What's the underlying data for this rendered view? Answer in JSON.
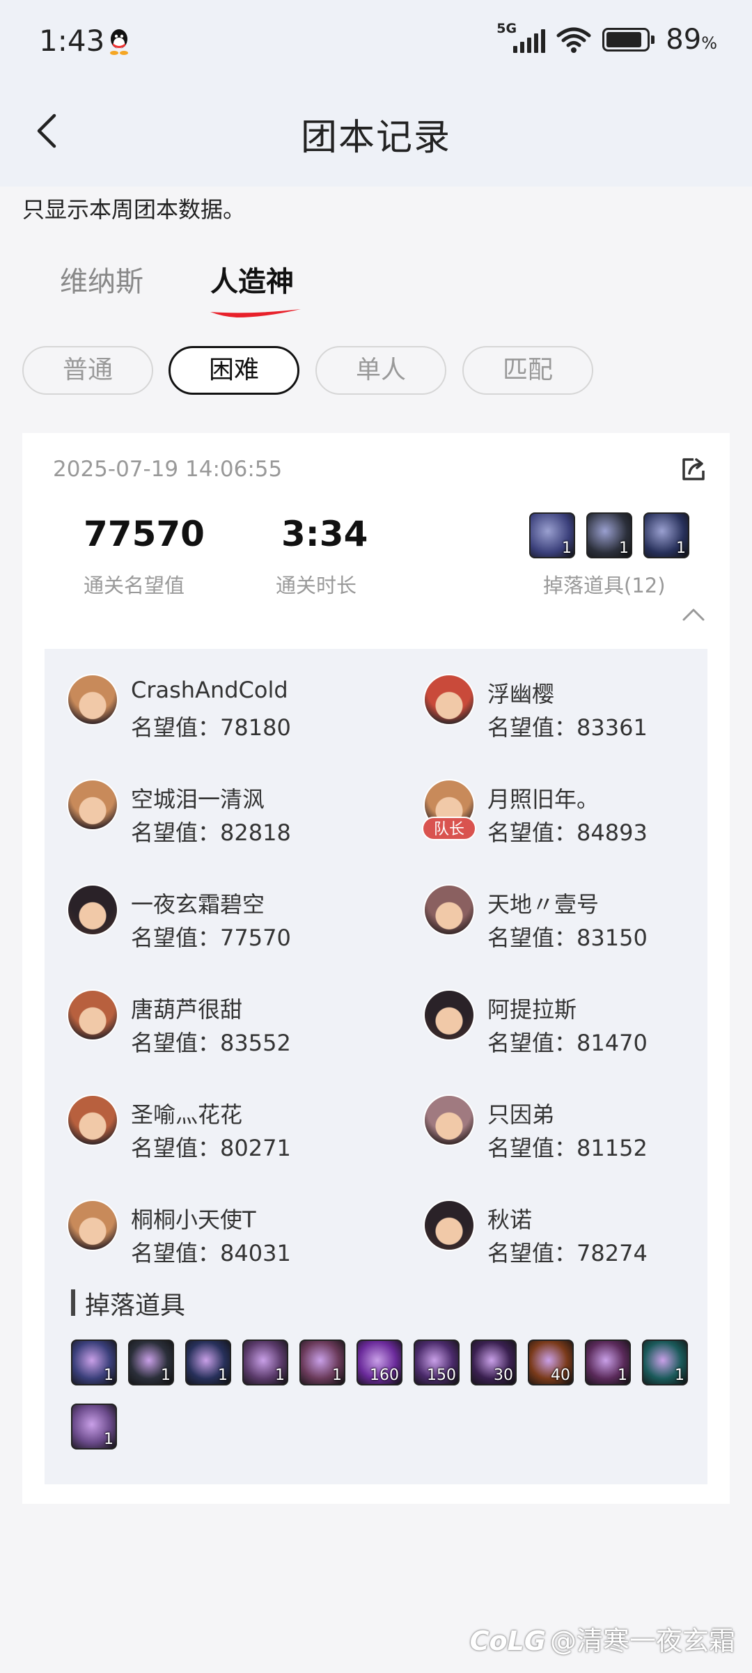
{
  "status_bar": {
    "time": "1:43",
    "network": "5G",
    "battery_percent": "89",
    "battery_unit": "%"
  },
  "header": {
    "title": "团本记录"
  },
  "notice": "只显示本周团本数据。",
  "raid_tabs": [
    {
      "label": "维纳斯",
      "active": false
    },
    {
      "label": "人造神",
      "active": true
    }
  ],
  "difficulty_tabs": [
    {
      "label": "普通",
      "active": false
    },
    {
      "label": "困难",
      "active": true
    },
    {
      "label": "单人",
      "active": false
    },
    {
      "label": "匹配",
      "active": false
    }
  ],
  "record": {
    "datetime": "2025-07-19 14:06:55",
    "stats": [
      {
        "value": "77570",
        "label": "通关名望值"
      },
      {
        "value": "3:34",
        "label": "通关时长"
      }
    ],
    "drops_summary_label": "掉落道具(12)",
    "mini_drops": [
      {
        "icon": "hammer-item-icon",
        "count": "1",
        "color": "#3a3f7a"
      },
      {
        "icon": "ring-item-icon",
        "count": "1",
        "color": "#2b2f3a"
      },
      {
        "icon": "orb-cannon-item-icon",
        "count": "1",
        "color": "#27305a"
      }
    ],
    "members": [
      {
        "name": "CrashAndCold",
        "rep": "名望值：78180",
        "avatar": "slayer-avatar",
        "tone": "#c88a5a",
        "leader": false
      },
      {
        "name": "浮幽樱",
        "rep": "名望值：83361",
        "avatar": "red-hair-avatar",
        "tone": "#c94a3a",
        "leader": false
      },
      {
        "name": "空城泪一清沨",
        "rep": "名望值：82818",
        "avatar": "slayer-avatar",
        "tone": "#c88a5a",
        "leader": false
      },
      {
        "name": "月照旧年。",
        "rep": "名望值：84893",
        "avatar": "slayer-avatar",
        "tone": "#c88a5a",
        "leader": true,
        "leader_label": "队长"
      },
      {
        "name": "一夜玄霜碧空",
        "rep": "名望值：77570",
        "avatar": "dark-hair-avatar",
        "tone": "#2a2228",
        "leader": false
      },
      {
        "name": "天地〃壹号",
        "rep": "名望值：83150",
        "avatar": "silver-hair-avatar",
        "tone": "#8a6060",
        "leader": false
      },
      {
        "name": "唐葫芦很甜",
        "rep": "名望值：83552",
        "avatar": "brown-hair-avatar",
        "tone": "#b8603e",
        "leader": false
      },
      {
        "name": "阿提拉斯",
        "rep": "名望值：81470",
        "avatar": "dark-hair-avatar",
        "tone": "#2a2228",
        "leader": false
      },
      {
        "name": "圣喻灬花花",
        "rep": "名望值：80271",
        "avatar": "brown-hair-avatar",
        "tone": "#b8603e",
        "leader": false
      },
      {
        "name": "只因弟",
        "rep": "名望值：81152",
        "avatar": "white-hair-avatar",
        "tone": "#a07a80",
        "leader": false
      },
      {
        "name": "桐桐小天使T",
        "rep": "名望值：84031",
        "avatar": "slayer-avatar",
        "tone": "#c88a5a",
        "leader": false
      },
      {
        "name": "秋诺",
        "rep": "名望值：78274",
        "avatar": "dark-hair-avatar",
        "tone": "#2a2228",
        "leader": false
      }
    ],
    "drops_heading": "掉落道具",
    "drops": [
      {
        "icon": "hammer-item-icon",
        "count": "1",
        "color": "#3a3f7a"
      },
      {
        "icon": "ring-item-icon",
        "count": "1",
        "color": "#2b2f3a"
      },
      {
        "icon": "orb-cannon-item-icon",
        "count": "1",
        "color": "#27305a"
      },
      {
        "icon": "gauntlet-item-icon",
        "count": "1",
        "color": "#5a3a6a"
      },
      {
        "icon": "bracelet-item-icon",
        "count": "1",
        "color": "#6a3a5a"
      },
      {
        "icon": "purple-orb-item-icon",
        "count": "160",
        "color": "#6a2a9a"
      },
      {
        "icon": "purple-shard-item-icon",
        "count": "150",
        "color": "#4a2a6a"
      },
      {
        "icon": "purple-swirl-item-icon",
        "count": "30",
        "color": "#3a2050"
      },
      {
        "icon": "fire-ring-item-icon",
        "count": "40",
        "color": "#7a3a1a"
      },
      {
        "icon": "cube-item-icon",
        "count": "1",
        "color": "#5a2a5a"
      },
      {
        "icon": "teal-crystal-item-icon",
        "count": "1",
        "color": "#1a5a5a"
      },
      {
        "icon": "claw-item-icon",
        "count": "1",
        "color": "#6a4a8a"
      }
    ]
  },
  "watermark": {
    "logo": "CoLG",
    "text": "@清寒一夜玄霜"
  }
}
